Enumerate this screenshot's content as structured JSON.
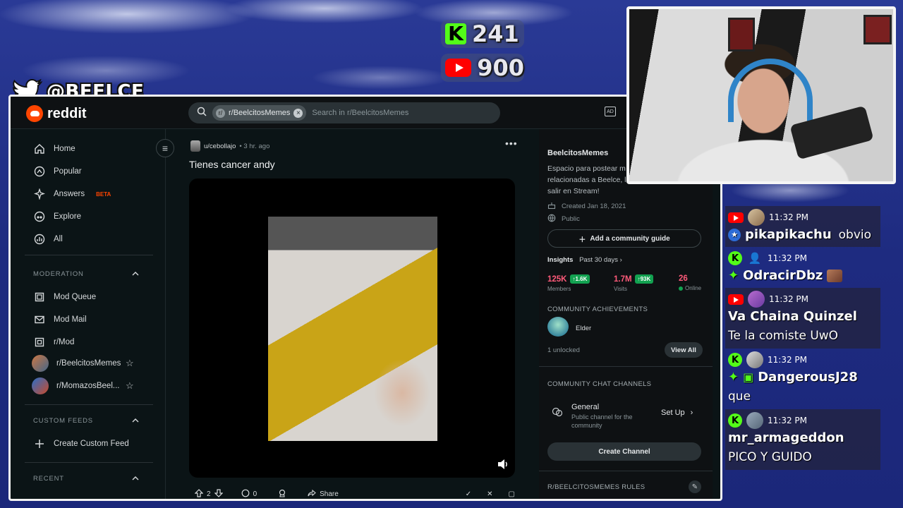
{
  "overlay": {
    "kick_count": "241",
    "youtube_count": "900",
    "twitter_handle": "@BEELCE_"
  },
  "reddit": {
    "brand": "reddit",
    "search": {
      "chip": "r/BeelcitosMemes",
      "placeholder": "Search in r/BeelcitosMemes"
    },
    "nav": [
      {
        "label": "Home",
        "icon": "home-icon"
      },
      {
        "label": "Popular",
        "icon": "popular-icon"
      },
      {
        "label": "Answers",
        "icon": "answers-icon",
        "badge": "BETA"
      },
      {
        "label": "Explore",
        "icon": "explore-icon"
      },
      {
        "label": "All",
        "icon": "all-icon"
      }
    ],
    "moderation": {
      "heading": "MODERATION",
      "items": [
        "Mod Queue",
        "Mod Mail",
        "r/Mod",
        "r/BeelcitosMemes",
        "r/MomazosBeel..."
      ]
    },
    "custom_feeds": {
      "heading": "CUSTOM FEEDS",
      "create": "Create Custom Feed"
    },
    "recent": {
      "heading": "RECENT"
    },
    "post": {
      "author": "u/cebollajo",
      "time": "• 3 hr. ago",
      "title": "Tienes cancer andy",
      "upvotes": "2",
      "comments": "0",
      "share": "Share"
    },
    "sidebar": {
      "name": "BeelcitosMemes",
      "description": "Espacio para postear m relacionadas a Beelce, lo salir en Stream!",
      "created": "Created Jan 18, 2021",
      "visibility": "Public",
      "guide_button": "Add a community guide",
      "insights_label": "Insights",
      "insights_range": "Past 30 days ›",
      "members": "125K",
      "members_delta": "↑1.6K",
      "members_label": "Members",
      "visits": "1.7M",
      "visits_delta": "↑93K",
      "visits_label": "Visits",
      "online": "26",
      "online_label": "Online",
      "achievements_heading": "COMMUNITY ACHIEVEMENTS",
      "achievement": "Elder",
      "unlocked": "1 unlocked",
      "view_all": "View All",
      "chat_heading": "COMMUNITY CHAT CHANNELS",
      "channel_name": "General",
      "channel_desc": "Public channel for the community",
      "setup": "Set Up",
      "create_channel": "Create Channel",
      "rules_heading": "R/BEELCITOSMEMES RULES"
    }
  },
  "chat": [
    {
      "platform": "youtube",
      "time": "11:32 PM",
      "name": "pikapikachu",
      "text": "obvio",
      "inline": true
    },
    {
      "platform": "kick",
      "time": "11:32 PM",
      "name": "OdracirDbz",
      "text": "",
      "inline": true
    },
    {
      "platform": "youtube",
      "time": "11:32 PM",
      "name": "Va Chaina Quinzel",
      "text": "Te la comiste UwO",
      "inline": false
    },
    {
      "platform": "kick",
      "time": "11:32 PM",
      "name": "DangerousJ28",
      "text": "que",
      "inline": false
    },
    {
      "platform": "kick",
      "time": "11:32 PM",
      "name": "mr_armageddon",
      "text": "PICO Y GUIDO",
      "inline": false
    }
  ]
}
